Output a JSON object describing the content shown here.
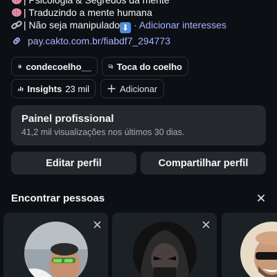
{
  "bio": {
    "line1": "| Psicologia & Segredos da mente",
    "line2": "| Traduzindo a mente humana",
    "line3": "| Não seja manipulado",
    "add_interests": "· Adicionar interesses"
  },
  "link": {
    "url": "pay.cakto.com.br/fiabdf7_294773"
  },
  "chips": {
    "threads": "condecoelho__",
    "toca": "Toca do coelho",
    "insights_label": "Insights",
    "insights_value": "23 mil",
    "add": "Adicionar"
  },
  "panel": {
    "title": "Painel profissional",
    "subtitle": "41,2 mil visualizações nos últimos 30 dias."
  },
  "buttons": {
    "edit": "Editar perfil",
    "share": "Compartilhar perfil"
  },
  "suggestions": {
    "title": "Encontrar pessoas"
  },
  "colors": {
    "background": "#0c1014",
    "card": "#25292e",
    "link": "#a8b4ff"
  }
}
